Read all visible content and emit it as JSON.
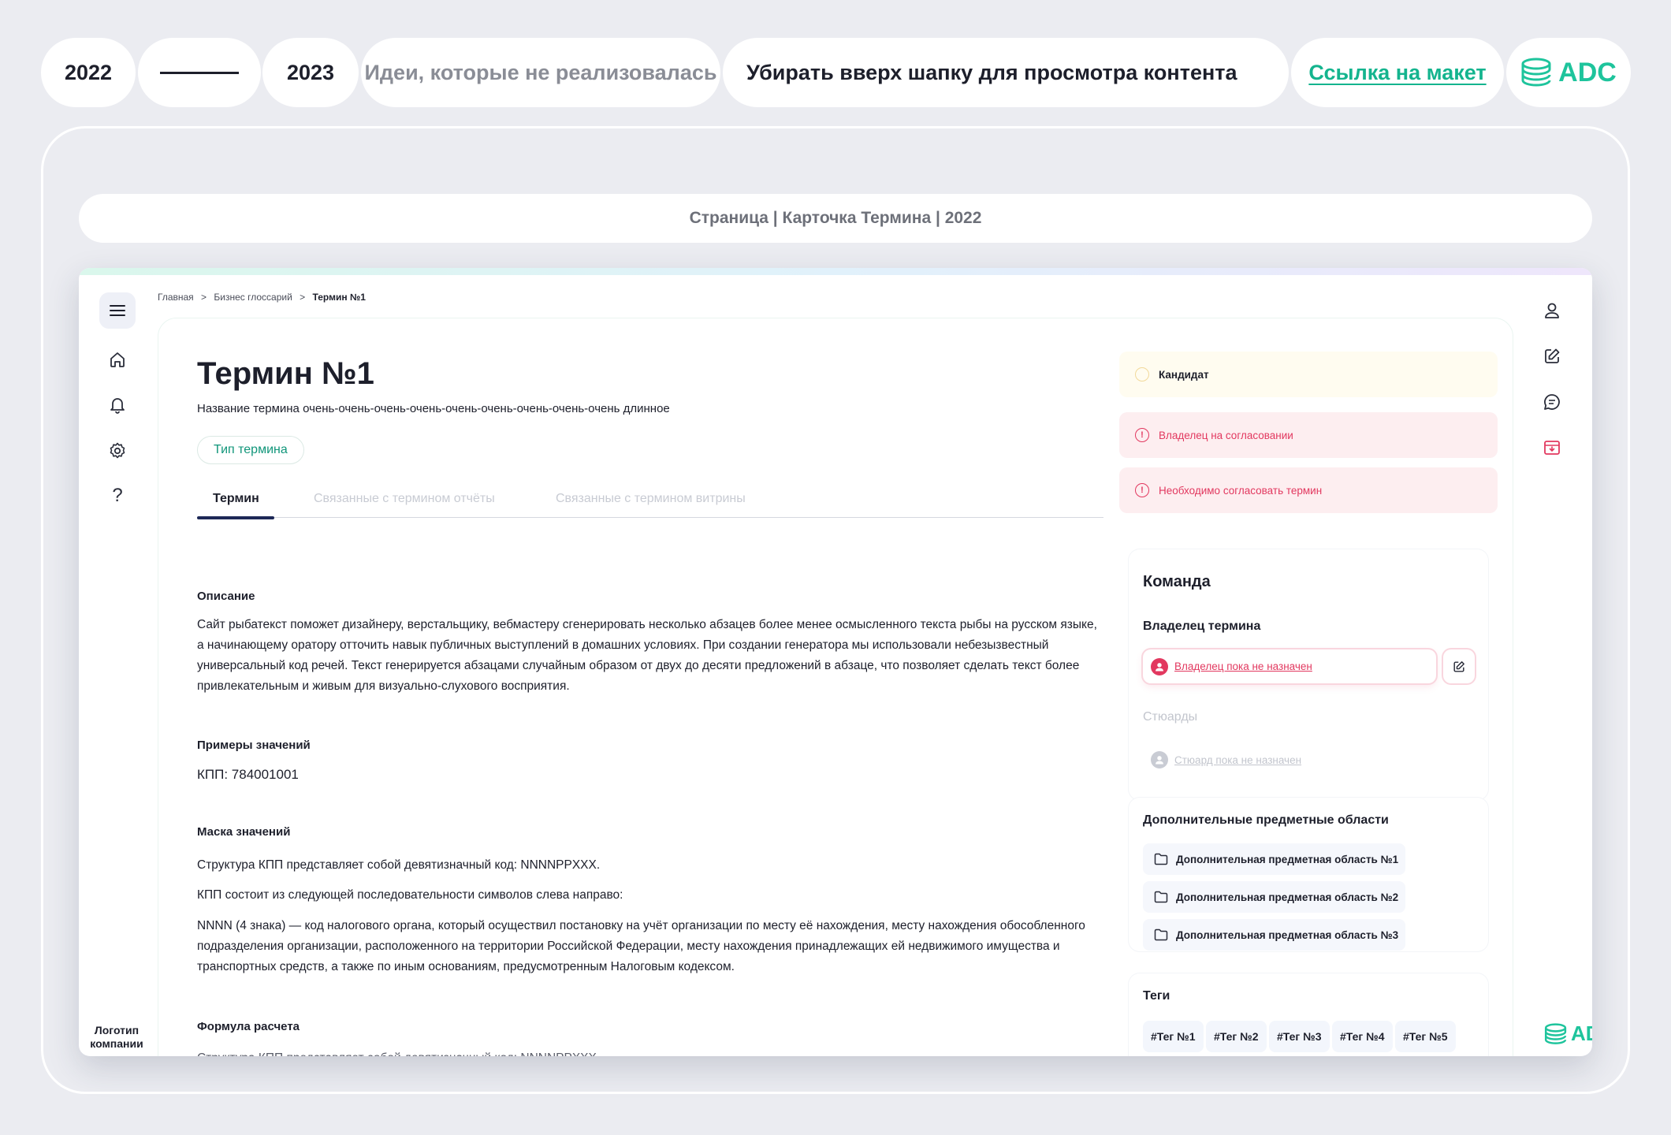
{
  "topbar": {
    "year_start": "2022",
    "year_end": "2023",
    "section": "Идеи, которые не реализовалась",
    "idea": "Убирать вверх шапку для просмотра контента",
    "link": "Ссылка  на макет",
    "brand": "ADC"
  },
  "page_title": "Страница | Карточка Термина | 2022",
  "breadcrumbs": [
    "Главная",
    ">",
    "Бизнес глоссарий",
    ">",
    "Термин №1"
  ],
  "term": {
    "title": "Термин №1",
    "subtitle": "Название термина очень-очень-очень-очень-очень-очень-очень-очень-очень длинное",
    "type_button": "Тип термина"
  },
  "tabs": [
    "Термин",
    "Связанные с термином отчёты",
    "Связанные с термином витрины"
  ],
  "sections": {
    "description_h": "Описание",
    "description": "Сайт рыбатекст поможет дизайнеру, верстальщику, вебмастеру сгенерировать несколько абзацев более менее осмысленного текста рыбы на русском языке, а начинающему оратору отточить навык публичных выступлений в домашних условиях. При создании генератора мы использовали небезызвестный универсальный код речей. Текст генерируется абзацами случайным образом от двух до десяти предложений в абзаце, что позволяет сделать текст более привлекательным и живым для визуально-слухового восприятия.",
    "examples_h": "Примеры значений",
    "examples": "КПП: 784001001",
    "mask_h": "Маска значений",
    "mask_1": "Структура КПП представляет собой девятизначный код: NNNNPPXXX.",
    "mask_2": "КПП состоит из следующей последовательности символов слева направо:",
    "mask_3": "NNNN (4 знака) — код налогового органа, который осуществил постановку на учёт организации по месту её нахождения, месту нахождения обособленного подразделения организации, расположенного на территории Российской Федерации, месту нахождения принадлежащих ей недвижимого имущества и транспортных средств, а также по иным основаниям, предусмотренным Налоговым кодексом.",
    "formula_h": "Формула расчета",
    "formula": "Структура КПП представляет собой девятизначный код: NNNNPPXXX."
  },
  "statuses": {
    "candidate": "Кандидат",
    "owner_approval": "Владелец  на согласовании",
    "need_approval": "Необходимо согласовать термин"
  },
  "team": {
    "title": "Команда",
    "owner_label": "Владелец термина",
    "owner_value": "Владелец пока не назначен",
    "stewards_label": "Стюарды",
    "steward_value": "Стюард пока не назначен"
  },
  "areas": {
    "title": "Дополнительные предметные области",
    "items": [
      "Дополнительная предметная область №1",
      "Дополнительная предметная область №2",
      "Дополнительная предметная область №3"
    ]
  },
  "tags": {
    "title": "Теги",
    "items": [
      "#Тег №1",
      "#Тег №2",
      "#Тег №3",
      "#Тег №4",
      "#Тег №5"
    ]
  },
  "sidebar": {
    "company_logo": "Логотип компании",
    "icons": [
      "menu-icon",
      "home-icon",
      "bell-icon",
      "gear-icon",
      "help-icon"
    ]
  },
  "right_bar": {
    "icons": [
      "user-icon",
      "edit-icon",
      "chat-icon",
      "inbox-icon"
    ],
    "brand": "AD"
  },
  "colors": {
    "accent": "#1ec49c",
    "danger": "#e2385f",
    "background": "#ebecf1"
  }
}
